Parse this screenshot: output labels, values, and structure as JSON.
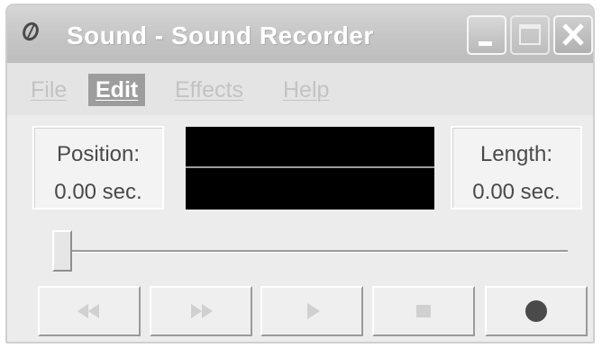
{
  "window": {
    "title": "Sound - Sound Recorder",
    "title_icon": "sound-recorder-app-icon",
    "controls": [
      "minimize-icon",
      "maximize-icon",
      "close-icon"
    ]
  },
  "menu": {
    "items": [
      {
        "label": "File",
        "state": "disabled"
      },
      {
        "label": "Edit",
        "state": "highlighted"
      },
      {
        "label": "Effects",
        "state": "disabled"
      },
      {
        "label": "Help",
        "state": "disabled"
      }
    ]
  },
  "position": {
    "label": "Position:",
    "value": "0.00 sec."
  },
  "length": {
    "label": "Length:",
    "value": "0.00 sec."
  },
  "seek": {
    "fraction": 0
  },
  "transport": {
    "buttons": [
      {
        "icon": "rewind-icon",
        "enabled": false
      },
      {
        "icon": "fast-forward-icon",
        "enabled": false
      },
      {
        "icon": "play-icon",
        "enabled": false
      },
      {
        "icon": "stop-icon",
        "enabled": false
      },
      {
        "icon": "record-icon",
        "enabled": true
      }
    ]
  },
  "colors": {
    "window_bg": "#e3e3e3",
    "waveform_bg": "#000000",
    "record_dot": "#4a4a4a",
    "disabled_icon": "#d0d0d0",
    "menu_highlight": "#9d9d9d"
  }
}
